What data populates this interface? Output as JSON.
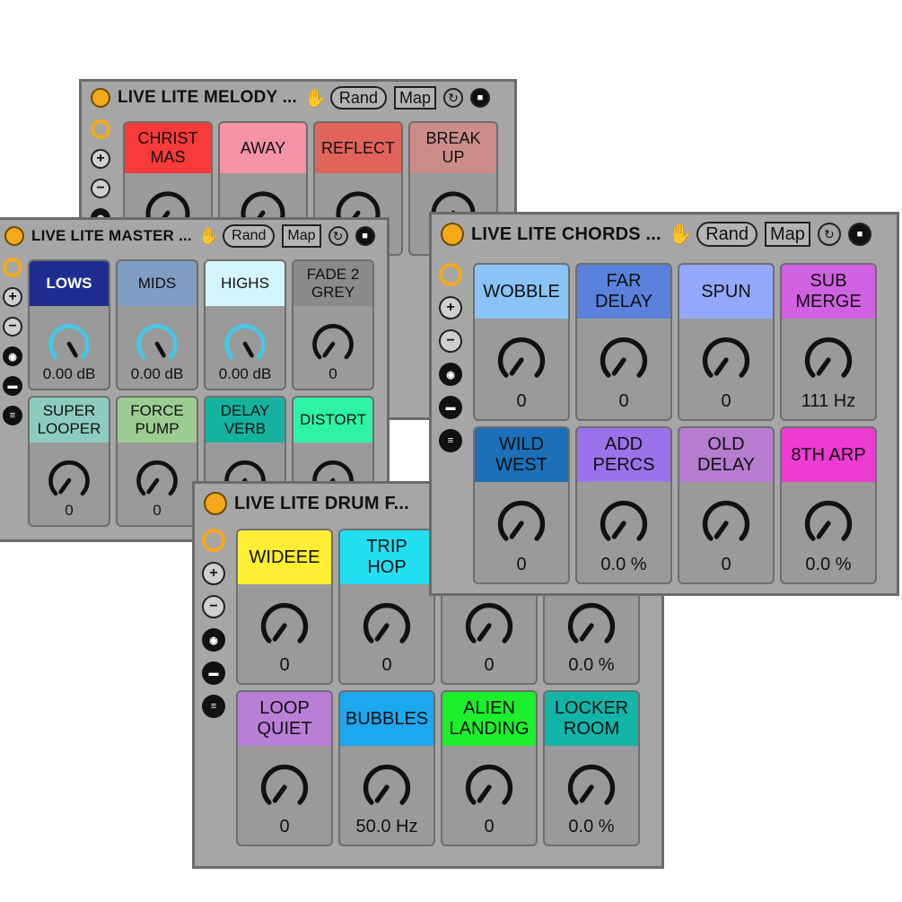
{
  "melody": {
    "title": "LIVE LITE MELODY ...",
    "rand": "Rand",
    "map": "Map",
    "cells": [
      {
        "label": "CHRIST\nMAS",
        "color": "#f83a3a"
      },
      {
        "label": "AWAY",
        "color": "#f592a4"
      },
      {
        "label": "REFLECT",
        "color": "#e0645a"
      },
      {
        "label": "BREAK\nUP",
        "color": "#cc8d88"
      }
    ]
  },
  "master": {
    "title": "LIVE LITE MASTER ...",
    "rand": "Rand",
    "map": "Map",
    "cells": [
      {
        "label": "LOWS",
        "color": "#1e2d90",
        "text": "#ffffff",
        "value": "0.00 dB",
        "knob": "blue"
      },
      {
        "label": "MIDS",
        "color": "#7f9dc2",
        "value": "0.00 dB",
        "knob": "blue"
      },
      {
        "label": "HIGHS",
        "color": "#d4f5fb",
        "value": "0.00 dB",
        "knob": "blue"
      },
      {
        "label": "FADE 2\nGREY",
        "color": "#8a8a8a",
        "value": "0",
        "knob": "dark"
      },
      {
        "label": "SUPER\nLOOPER",
        "color": "#8ecbbf",
        "value": "0",
        "knob": "dark"
      },
      {
        "label": "FORCE\nPUMP",
        "color": "#9ccc92",
        "value": "0",
        "knob": "dark"
      },
      {
        "label": "DELAY\nVERB",
        "color": "#14b3a0",
        "value": "",
        "knob": "dark"
      },
      {
        "label": "DISTORT",
        "color": "#2ef3a6",
        "value": "",
        "knob": "dark"
      }
    ]
  },
  "chords": {
    "title": "LIVE LITE CHORDS ...",
    "rand": "Rand",
    "map": "Map",
    "cells": [
      {
        "label": "WOBBLE",
        "color": "#89c3f7",
        "value": "0"
      },
      {
        "label": "FAR\nDELAY",
        "color": "#5a82dc",
        "value": "0"
      },
      {
        "label": "SPUN",
        "color": "#93a8fb",
        "value": "0"
      },
      {
        "label": "SUB\nMERGE",
        "color": "#d061e2",
        "value": "111 Hz"
      },
      {
        "label": "WILD\nWEST",
        "color": "#1b70b8",
        "value": "0"
      },
      {
        "label": "ADD\nPERCS",
        "color": "#9b72ea",
        "value": "0.0 %"
      },
      {
        "label": "OLD\nDELAY",
        "color": "#b57cd0",
        "value": "0"
      },
      {
        "label": "8TH ARP",
        "color": "#ee3bd1",
        "value": "0.0 %"
      }
    ]
  },
  "drum": {
    "title": "LIVE LITE DRUM F...",
    "cells": [
      {
        "label": "WIDEEE",
        "color": "#ffee33",
        "value": "0"
      },
      {
        "label": "TRIP\nHOP",
        "color": "#22e0f2",
        "value": "0"
      },
      {
        "label": "",
        "color": "#9a9a9a",
        "value": "0"
      },
      {
        "label": "",
        "color": "#9a9a9a",
        "value": "0.0 %"
      },
      {
        "label": "LOOP\nQUIET",
        "color": "#b97fd6",
        "value": "0"
      },
      {
        "label": "BUBBLES",
        "color": "#1da7ef",
        "value": "50.0 Hz"
      },
      {
        "label": "ALIEN\nLANDING",
        "color": "#1cf02c",
        "value": "0"
      },
      {
        "label": "LOCKER\nROOM",
        "color": "#12b5a8",
        "value": "0.0 %"
      }
    ]
  },
  "colors": {
    "panel": "#a6a6a6",
    "power": "#f4a81a",
    "knob_blue": "#44c7ea"
  },
  "icons": [
    "power-icon",
    "hand-icon",
    "sync-icon",
    "save-icon",
    "swirl-icon",
    "plus-icon",
    "minus-icon",
    "camera-icon",
    "rect-icon",
    "list-icon"
  ]
}
